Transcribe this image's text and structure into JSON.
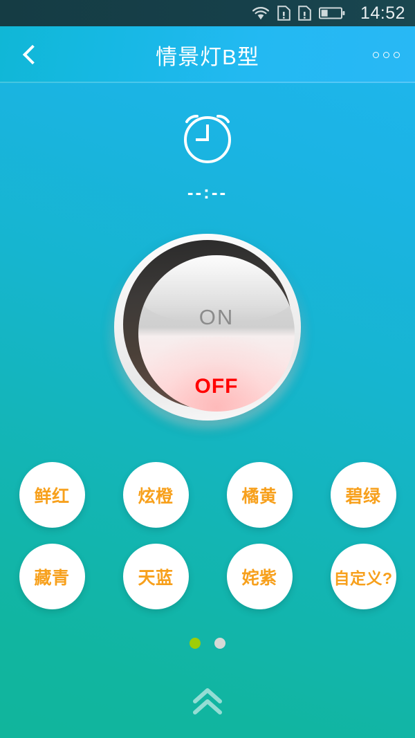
{
  "status_bar": {
    "time": "14:52",
    "icons": [
      "wifi-icon",
      "sim-card-alert-icon",
      "sim-card-alert-icon",
      "battery-low-icon"
    ],
    "battery_level_pct": 33,
    "background_color": "#16404a"
  },
  "title_bar": {
    "back_label": "back",
    "title": "情景灯B型",
    "more_label": "more options",
    "background_color": "#1fb8ef"
  },
  "timer": {
    "icon": "alarm-clock-icon",
    "value": "--:--"
  },
  "power_knob": {
    "on_label": "ON",
    "off_label": "OFF",
    "on_color": "#8b8b8b",
    "off_color": "#ff0000",
    "state": "OFF"
  },
  "scenes": {
    "text_color": "#f7a01c",
    "buttons": [
      {
        "label": "鲜红"
      },
      {
        "label": "炫橙"
      },
      {
        "label": "橘黄"
      },
      {
        "label": "碧绿"
      },
      {
        "label": "藏青"
      },
      {
        "label": "天蓝"
      },
      {
        "label": "姹紫"
      },
      {
        "label": "自定义?"
      }
    ]
  },
  "pager": {
    "total": 2,
    "current": 1,
    "active_color": "#9ecd08",
    "idle_color": "#d6d9d6"
  },
  "bottom_handle": {
    "icon": "chevron-double-up-icon"
  },
  "background": {
    "top_color": "#20b6ef",
    "bottom_color": "#11b59c"
  }
}
